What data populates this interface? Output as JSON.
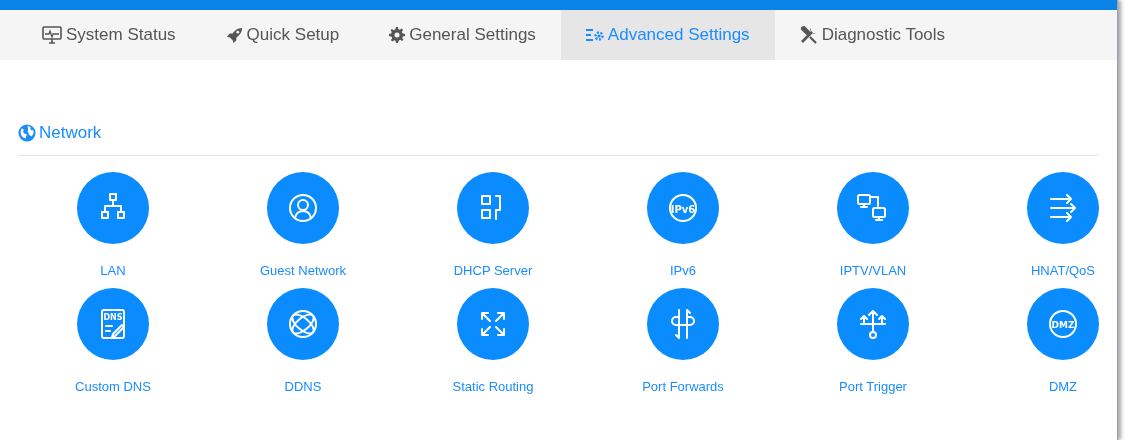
{
  "tabs": [
    {
      "kind": "monitor",
      "label": "System Status",
      "selected": false
    },
    {
      "kind": "rocket",
      "label": "Quick Setup",
      "selected": false
    },
    {
      "kind": "gear",
      "label": "General Settings",
      "selected": false
    },
    {
      "kind": "advanced",
      "label": "Advanced Settings",
      "selected": true
    },
    {
      "kind": "tools",
      "label": "Diagnostic Tools",
      "selected": false
    }
  ],
  "section": {
    "title": "Network"
  },
  "items": [
    {
      "kind": "lan",
      "label": "LAN"
    },
    {
      "kind": "guest",
      "label": "Guest Network"
    },
    {
      "kind": "dhcp",
      "label": "DHCP Server"
    },
    {
      "kind": "ipv6",
      "label": "IPv6",
      "icon_text": "IPv6"
    },
    {
      "kind": "iptv",
      "label": "IPTV/VLAN"
    },
    {
      "kind": "hnat",
      "label": "HNAT/QoS"
    },
    {
      "kind": "dns",
      "label": "Custom DNS",
      "icon_text": "DNS"
    },
    {
      "kind": "ddns",
      "label": "DDNS"
    },
    {
      "kind": "routing",
      "label": "Static Routing"
    },
    {
      "kind": "forward",
      "label": "Port Forwards"
    },
    {
      "kind": "trigger",
      "label": "Port Trigger"
    },
    {
      "kind": "dmz",
      "label": "DMZ",
      "icon_text": "DMZ"
    }
  ]
}
